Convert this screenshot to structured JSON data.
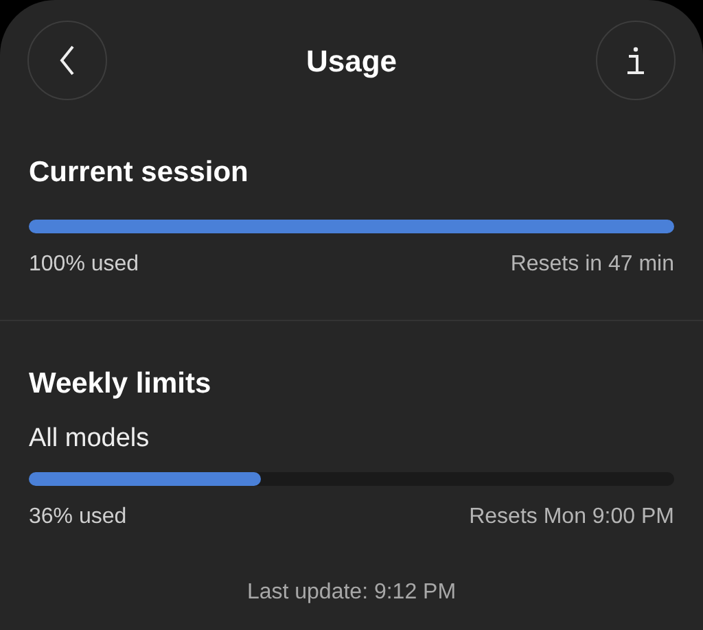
{
  "header": {
    "title": "Usage"
  },
  "sections": [
    {
      "title": "Current session",
      "meters": [
        {
          "level": 1.0,
          "used": "100% used",
          "resets": "Resets in 47 min"
        }
      ]
    },
    {
      "title": "Weekly limits",
      "meters": [
        {
          "label": "All models",
          "level": 0.36,
          "used": "36% used",
          "resets": "Resets Mon 9:00 PM"
        }
      ]
    }
  ],
  "footer": {
    "last_update": "Last update: 9:12 PM"
  }
}
